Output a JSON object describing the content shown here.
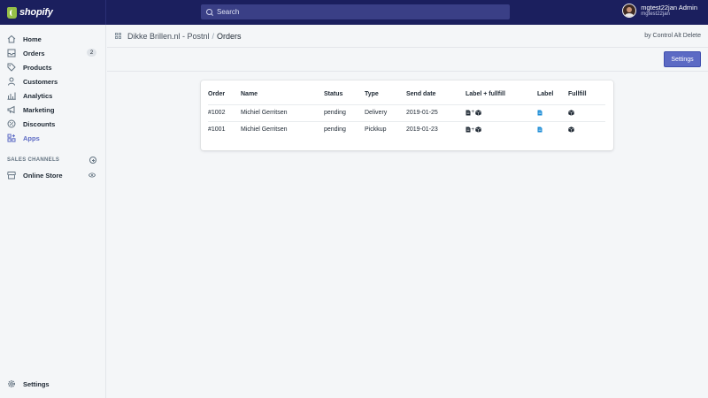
{
  "topbar": {
    "logo_text": "shopify",
    "search_placeholder": "Search",
    "user_name": "mgtest22jan Admin",
    "user_store": "mgtest22jan"
  },
  "sidebar": {
    "items": [
      {
        "label": "Home",
        "icon": "home-icon"
      },
      {
        "label": "Orders",
        "icon": "orders-icon",
        "badge": "2"
      },
      {
        "label": "Products",
        "icon": "tag-icon"
      },
      {
        "label": "Customers",
        "icon": "person-icon"
      },
      {
        "label": "Analytics",
        "icon": "bar-chart-icon"
      },
      {
        "label": "Marketing",
        "icon": "megaphone-icon"
      },
      {
        "label": "Discounts",
        "icon": "discount-icon"
      },
      {
        "label": "Apps",
        "icon": "apps-icon",
        "active": true
      }
    ],
    "sales_channels_label": "SALES CHANNELS",
    "online_store_label": "Online Store",
    "settings_label": "Settings"
  },
  "header": {
    "breadcrumb_app": "Dikke Brillen.nl - Postnl",
    "breadcrumb_sep": "/",
    "breadcrumb_page": "Orders",
    "byline": "by Control Alt Delete"
  },
  "toolbar": {
    "settings_label": "Settings"
  },
  "table": {
    "headers": [
      "Order",
      "Name",
      "Status",
      "Type",
      "Send date",
      "Label + fullfill",
      "Label",
      "Fullfill"
    ],
    "rows": [
      {
        "order": "#1002",
        "name": "Michiel Gerritsen",
        "status": "pending",
        "type": "Delivery",
        "send_date": "2019-01-25"
      },
      {
        "order": "#1001",
        "name": "Michiel Gerritsen",
        "status": "pending",
        "type": "Pickkup",
        "send_date": "2019-01-23"
      }
    ],
    "plus_glyph": "+"
  },
  "colors": {
    "topbar": "#1b1f5e",
    "accent": "#5c6ac4",
    "label_icon": "#1a8bd6"
  }
}
